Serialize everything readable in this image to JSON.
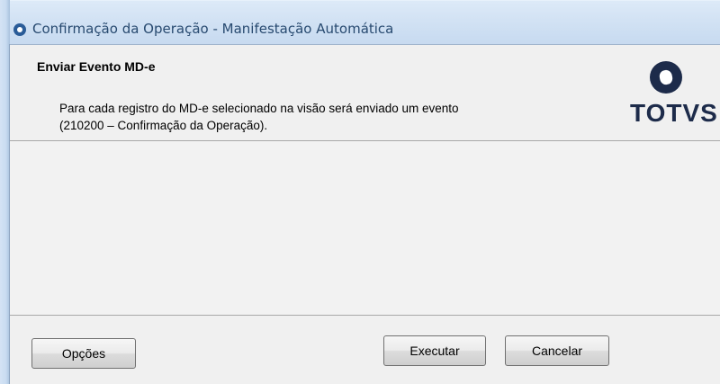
{
  "window": {
    "title": "Confirmação da Operação - Manifestação Automática"
  },
  "header": {
    "title": "Enviar Evento MD-e",
    "description_line1": "Para cada registro do MD-e selecionado na visão será enviado um evento",
    "description_line2": "(210200 – Confirmação da Operação).",
    "logo_text": "TOTVS"
  },
  "buttons": {
    "options": "Opções",
    "execute": "Executar",
    "cancel": "Cancelar"
  },
  "colors": {
    "titlebar": "#d2e2f4",
    "title_text": "#284a70",
    "panel_background": "#f0f0f0",
    "logo": "#1d2b4a"
  },
  "icons": {
    "title_icon": "app-circle-icon",
    "logo_mark": "totvs-logo-mark"
  }
}
